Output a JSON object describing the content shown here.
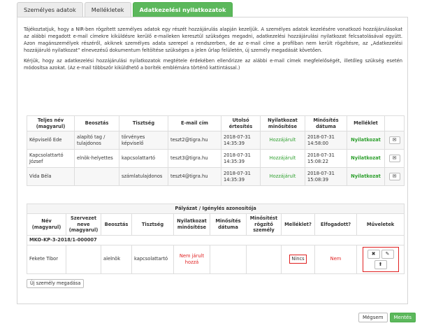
{
  "tabs": [
    {
      "label": "Személyes adatok"
    },
    {
      "label": "Mellékletek"
    },
    {
      "label": "Adatkezelési nyilatkozatok"
    }
  ],
  "intro": {
    "p1": "Tájékoztatjuk, hogy a NIR-ben rögzített személyes adatok egy részét hozzájárulás alapján kezeljük. A személyes adatok kezelésére vonatkozó hozzájárulásokat az alábbi megadott e-mail címekre kiküldésre kerülő e-maileken keresztül szükséges megadni, adatkezelési hozzájárulási nyilatkozat felcsatolásával együtt. Azon magánszemélyek részéről, akiknek személyes adata szerepel a rendszerben, de az e-mail címe a profilban nem került rögzítésre, az „Adatkezelési hozzájáruló nyilatkozat” elnevezésű dokumentum feltöltése szükséges a jelen űrlap felületén, új személy megadását követően.",
    "p2": "Kérjük, hogy az adatkezelési hozzájárulási nyilatkozatok megtétele érdekében ellenőrizze az alábbi e-mail címek megfelelőségét, illetőleg szükség esetén módosítsa azokat. (Az e-mail többször kiküldhető a boríték emblémára történő kattintással.)"
  },
  "table1": {
    "headers": [
      "Teljes név (magyarul)",
      "Beosztás",
      "Tisztség",
      "E-mail cím",
      "Utolsó értesítés",
      "Nyilatkozat minősítése",
      "Minősítés dátuma",
      "Melléklet",
      ""
    ],
    "rows": [
      {
        "name": "Képviselő Ede",
        "position": "alapító tag / tulajdonos",
        "role": "törvényes képviselő",
        "email": "teszt2@tigra.hu",
        "last_notice": "2018-07-31 14:35:39",
        "status": "Hozzájárult",
        "date": "2018-07-31 14:58:00",
        "attachment": "Nyilatkozat"
      },
      {
        "name": "Kapcsolattartó József",
        "position": "elnök-helyettes",
        "role": "kapcsolattartó",
        "email": "teszt3@tigra.hu",
        "last_notice": "2018-07-31 14:35:39",
        "status": "Hozzájárult",
        "date": "2018-07-31 15:08:22",
        "attachment": "Nyilatkozat"
      },
      {
        "name": "Vida Béla",
        "position": "",
        "role": "számlatulajdonos",
        "email": "teszt4@tigra.hu",
        "last_notice": "2018-07-31 14:35:39",
        "status": "Hozzájárult",
        "date": "2018-07-31 15:08:39",
        "attachment": "Nyilatkozat"
      }
    ]
  },
  "table2": {
    "caption": "Pályázat / Igénylés azonosítója",
    "headers": [
      "Név (magyarul)",
      "Szervezet neve (magyarul)",
      "Beosztás",
      "Tisztség",
      "Nyilatkozat minősítése",
      "Minősítés dátuma",
      "Minősítést rögzítő személy",
      "Melléklet?",
      "Elfogadott?",
      "Műveletek"
    ],
    "group": "MKO-KP-3-2018/1-000007",
    "row": {
      "name": "Fekete Tibor",
      "org": "",
      "position": "alelnök",
      "role": "kapcsolattartó",
      "status": "Nem járult hozzá",
      "date": "",
      "recorder": "",
      "attachment": "Nincs",
      "accepted": "Nem"
    }
  },
  "buttons": {
    "add_person": "Új személy megadása",
    "cancel": "Mégsem",
    "save": "Mentés"
  },
  "icons": {
    "mail": "envelope-icon",
    "delete": "close-icon",
    "edit": "pencil-icon",
    "upload": "upload-icon"
  },
  "colors": {
    "accent": "#5cb85c",
    "danger": "#e02020",
    "ok": "#2ea02e"
  }
}
